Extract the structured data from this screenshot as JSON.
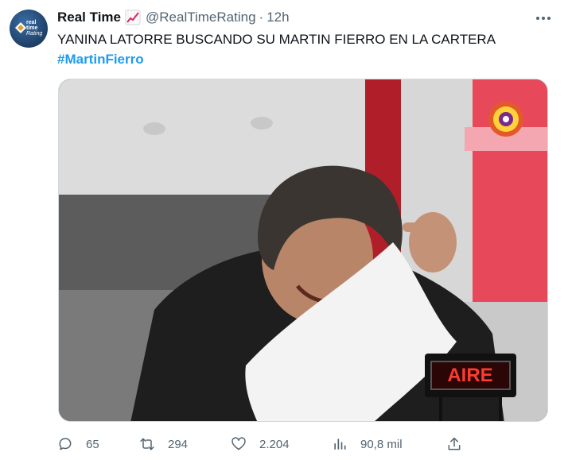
{
  "tweet": {
    "display_name": "Real Time",
    "name_emoji": "chart-increasing-emoji",
    "handle": "@RealTimeRating",
    "separator": "·",
    "time_ago": "12h",
    "text": "YANINA LATORRE BUSCANDO SU MARTIN FIERRO EN LA CARTERA",
    "hashtag": "#MartinFierro",
    "avatar_text": [
      "real",
      "time",
      "Rating"
    ],
    "media": {
      "description": "Video still: man laughing, hugging a white pillow; channel logo and on-air sign",
      "onair_sign": "AIRE"
    }
  },
  "actions": {
    "replies": "65",
    "retweets": "294",
    "likes": "2.204",
    "views": "90,8 mil"
  },
  "colors": {
    "text": "#0f1419",
    "secondary": "#536471",
    "link": "#1d9bf0"
  }
}
